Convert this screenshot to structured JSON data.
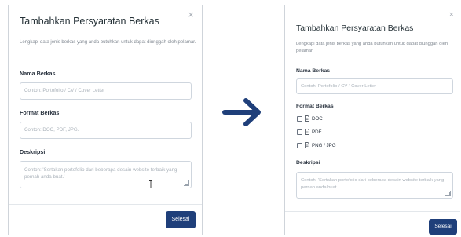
{
  "left_modal": {
    "title": "Tambahkan Persyaratan Berkas",
    "close_glyph": "×",
    "description": "Lengkapi data jenis berkas yang anda butuhkan untuk dapat diunggah oleh pelamar.",
    "name_label": "Nama Berkas",
    "name_placeholder": "Contoh: Portofolio / CV / Cover Letter",
    "format_label": "Format Berkas",
    "format_placeholder": "Contoh: DOC, PDF, JPG.",
    "desc_label": "Deskripsi",
    "desc_placeholder": "Contoh: 'Sertakan portofolio dari beberapa desain website terbaik yang pernah anda buat.'",
    "submit_label": "Selesai"
  },
  "right_modal": {
    "title": "Tambahkan Persyaratan Berkas",
    "close_glyph": "×",
    "description": "Lengkapi data jenis berkas yang anda butuhkan untuk dapat diunggah oleh pelamar.",
    "name_label": "Nama Berkas",
    "name_placeholder": "Contoh: Portofolio / CV / Cover Letter",
    "format_label": "Format Berkas",
    "format_options": [
      {
        "label": "DOC",
        "icon": "file-icon",
        "checked": false
      },
      {
        "label": "PDF",
        "icon": "file-icon",
        "checked": false
      },
      {
        "label": "PNG / JPG",
        "icon": "file-icon",
        "checked": false
      }
    ],
    "desc_label": "Deskripsi",
    "desc_placeholder": "Contoh: 'Sertakan portofolio dari beberapa desain website terbaik yang pernah anda buat.'",
    "submit_label": "Selesai"
  },
  "colors": {
    "primary_button": "#1f3f7a",
    "arrow": "#1f3f7a"
  }
}
